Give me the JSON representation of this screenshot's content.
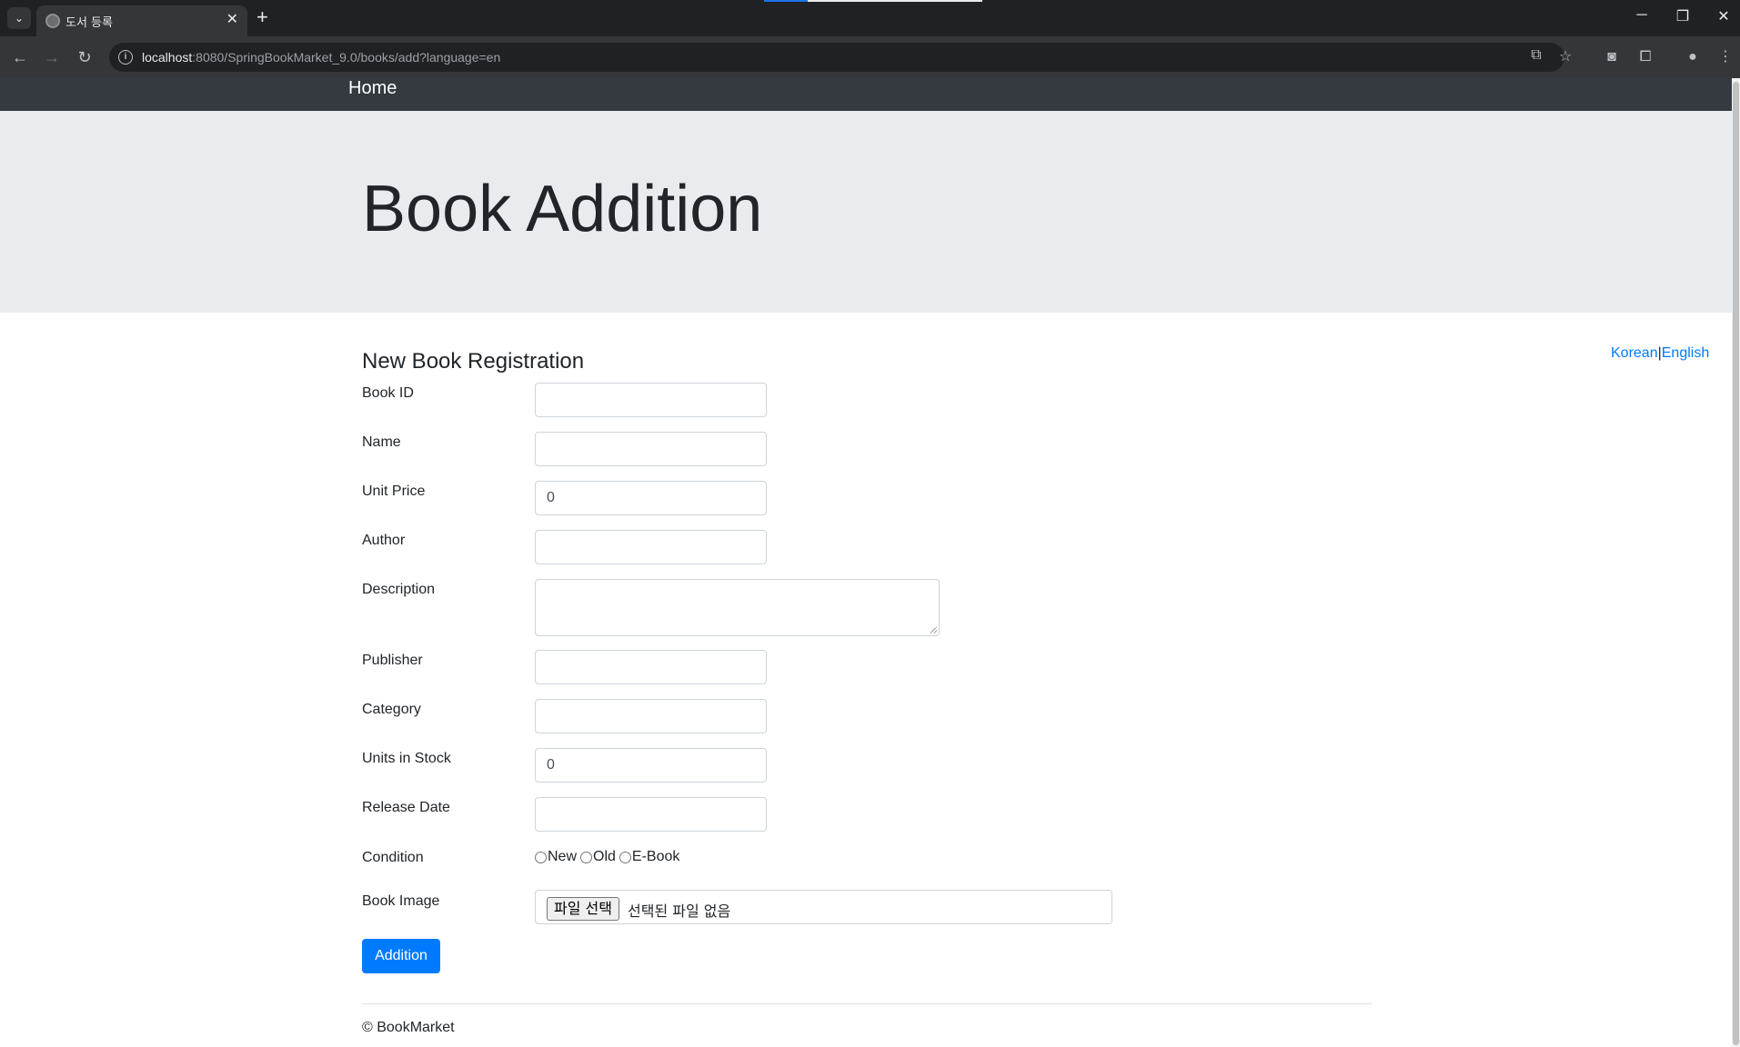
{
  "browser": {
    "tab_title": "도서 등록",
    "url_host": "localhost",
    "url_path": ":8080/SpringBookMarket_9.0/books/add?language=en"
  },
  "navbar": {
    "brand": "Home"
  },
  "jumbotron": {
    "title": "Book Addition"
  },
  "language": {
    "korean": "Korean",
    "separator": "|",
    "english": "English"
  },
  "form": {
    "legend": "New Book Registration",
    "labels": {
      "book_id": "Book ID",
      "name": "Name",
      "unit_price": "Unit Price",
      "author": "Author",
      "description": "Description",
      "publisher": "Publisher",
      "category": "Category",
      "units_in_stock": "Units in Stock",
      "release_date": "Release Date",
      "condition": "Condition",
      "book_image": "Book Image"
    },
    "values": {
      "book_id": "",
      "name": "",
      "unit_price": "0",
      "author": "",
      "description": "",
      "publisher": "",
      "category": "",
      "units_in_stock": "0",
      "release_date": ""
    },
    "condition_options": {
      "new": "New",
      "old": "Old",
      "ebook": "E-Book"
    },
    "file_button": "파일 선택",
    "file_status": "선택된 파일 없음",
    "submit": "Addition"
  },
  "footer": {
    "text": "© BookMarket"
  },
  "colors": {
    "primary": "#007bff",
    "navbar": "#343a40",
    "jumbotron": "#e9ecef"
  }
}
